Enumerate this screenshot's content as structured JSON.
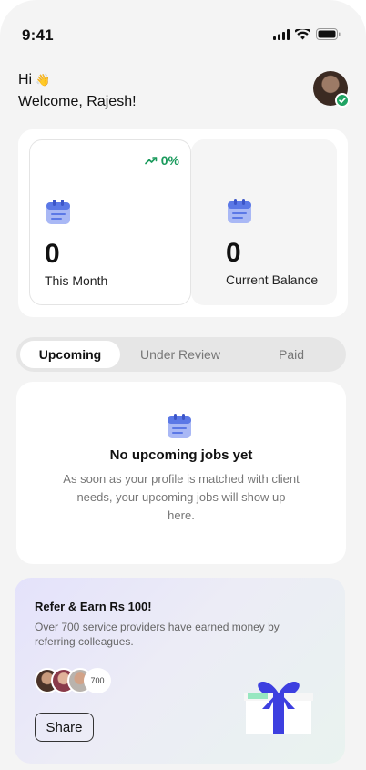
{
  "status_bar": {
    "time": "9:41"
  },
  "header": {
    "greeting": "Hi",
    "wave_emoji": "👋",
    "welcome": "Welcome, Rajesh!"
  },
  "stats": {
    "trend": "0%",
    "this_month": {
      "value": "0",
      "label": "This Month"
    },
    "current_balance": {
      "value": "0",
      "label": "Current Balance"
    }
  },
  "tabs": [
    {
      "label": "Upcoming",
      "active": true
    },
    {
      "label": "Under Review",
      "active": false
    },
    {
      "label": "Paid",
      "active": false
    }
  ],
  "empty_state": {
    "title": "No upcoming jobs yet",
    "description": "As soon as your profile is matched with client needs, your upcoming jobs will show up here."
  },
  "refer": {
    "title": "Refer & Earn Rs 100!",
    "description": "Over 700 service providers have earned money by referring colleagues.",
    "count": "700",
    "share_label": "Share"
  },
  "colors": {
    "accent_green": "#1a9a5c",
    "icon_blue": "#5b78e6",
    "gift_ribbon": "#3d3fe0"
  }
}
